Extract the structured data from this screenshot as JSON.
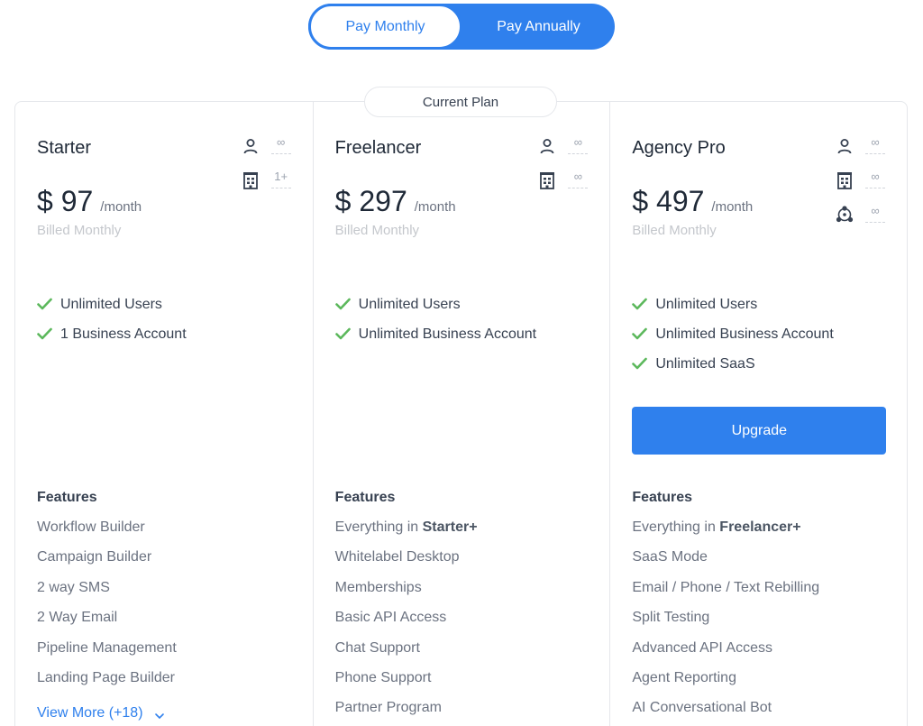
{
  "billing_toggle": {
    "monthly_label": "Pay Monthly",
    "annually_label": "Pay Annually",
    "selected": "monthly"
  },
  "current_plan_label": "Current Plan",
  "colors": {
    "accent": "#2f80ed",
    "check": "#5cb85c"
  },
  "plans": [
    {
      "name": "Starter",
      "price": "$ 97",
      "period": "/month",
      "billed": "Billed Monthly",
      "limits": [
        {
          "icon": "user-icon",
          "value": "∞"
        },
        {
          "icon": "building-icon",
          "value": "1+"
        }
      ],
      "highlights": [
        "Unlimited Users",
        "1 Business Account"
      ],
      "features_title": "Features",
      "features": [
        "Workflow Builder",
        "Campaign Builder",
        "2 way SMS",
        "2 Way Email",
        "Pipeline Management",
        "Landing Page Builder"
      ],
      "view_more": "View More (+18)"
    },
    {
      "name": "Freelancer",
      "price": "$ 297",
      "period": "/month",
      "billed": "Billed Monthly",
      "limits": [
        {
          "icon": "user-icon",
          "value": "∞"
        },
        {
          "icon": "building-icon",
          "value": "∞"
        }
      ],
      "highlights": [
        "Unlimited Users",
        "Unlimited Business Account"
      ],
      "features_title": "Features",
      "features_prefix": "Everything in",
      "features_prefix_bold": "Starter+",
      "features": [
        "Whitelabel Desktop",
        "Memberships",
        "Basic API Access",
        "Chat Support",
        "Phone Support",
        "Partner Program"
      ]
    },
    {
      "name": "Agency Pro",
      "price": "$ 497",
      "period": "/month",
      "billed": "Billed Monthly",
      "limits": [
        {
          "icon": "user-icon",
          "value": "∞"
        },
        {
          "icon": "building-icon",
          "value": "∞"
        },
        {
          "icon": "saas-network-icon",
          "value": "∞"
        }
      ],
      "highlights": [
        "Unlimited Users",
        "Unlimited Business Account",
        "Unlimited SaaS"
      ],
      "upgrade_label": "Upgrade",
      "features_title": "Features",
      "features_prefix": "Everything in",
      "features_prefix_bold": "Freelancer+",
      "features": [
        "SaaS Mode",
        "Email / Phone / Text Rebilling",
        "Split Testing",
        "Advanced API Access",
        "Agent Reporting",
        "AI Conversational Bot"
      ]
    }
  ]
}
